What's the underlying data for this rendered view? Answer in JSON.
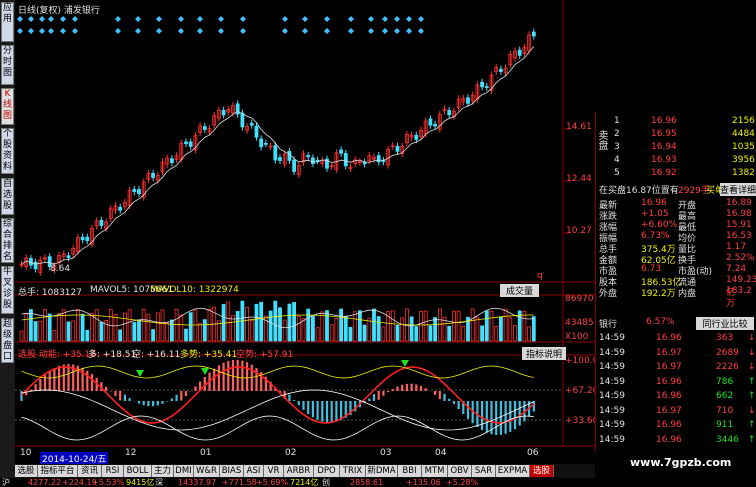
{
  "left_tabs": [
    {
      "label": "应用",
      "active": false
    },
    {
      "label": "分时图",
      "active": false
    },
    {
      "label": "K线图",
      "active": true
    },
    {
      "label": "个股资料",
      "active": false
    },
    {
      "label": "自选股",
      "active": false
    },
    {
      "label": "综合排名",
      "active": false
    },
    {
      "label": "牛叉诊股",
      "active": false
    },
    {
      "label": "超级盘口",
      "active": false
    }
  ],
  "chart_header": {
    "title": "日线(复权) 浦发银行"
  },
  "price_axis": {
    "labels": [
      "14.61",
      "12.44",
      "10.27"
    ],
    "low_marker": "8.64",
    "q_marker": "q"
  },
  "volume_header": {
    "total": "总手: 1083127",
    "mavol5": "MAVOL5: 1075661",
    "mavol10": "MAVOL10: 1322974",
    "dropdown": "成交量"
  },
  "volume_axis": {
    "labels": [
      "86970",
      "43485",
      "X100"
    ]
  },
  "indicator_header": {
    "name": "选股 动能: +35.18",
    "duo": "多: +18.51",
    "kong": "空: +16.11",
    "duoshi": "多势: +35.41",
    "kongshi": "空势: +57.91",
    "help": "指标说明"
  },
  "indicator_axis": {
    "labels": [
      "+100.0",
      "+67.20",
      "+33.60"
    ]
  },
  "x_axis": {
    "labels": [
      "10",
      "12",
      "01",
      "02",
      "03",
      "04",
      "06"
    ],
    "cursor_date": "2014-10-24/五"
  },
  "bottom_tabs": [
    "选股",
    "指标平台",
    "资讯",
    "RSI",
    "BOLL",
    "主力",
    "DMI",
    "W&R",
    "BIAS",
    "ASI",
    "VR",
    "ARBR",
    "DPO",
    "TRIX",
    "新DMA",
    "BBI",
    "MTM",
    "OBV",
    "SAR",
    "EXPMA",
    "选股"
  ],
  "active_bottom_tab": 20,
  "quote": {
    "sell_label": "卖盘",
    "asks": [
      {
        "level": "1",
        "price": "16.96",
        "vol": "2156"
      },
      {
        "level": "2",
        "price": "16.95",
        "vol": "4484"
      },
      {
        "level": "3",
        "price": "16.94",
        "vol": "1035"
      },
      {
        "level": "4",
        "price": "16.93",
        "vol": "3956"
      },
      {
        "level": "5",
        "price": "16.92",
        "vol": "1382"
      }
    ],
    "order_line": "在买盘16.87位置有",
    "order_vol": "2929手",
    "order_action": "买单!",
    "order_link": "查看详细",
    "stats": [
      {
        "l1": "最新",
        "v1": "16.96",
        "l2": "开盘",
        "v2": "16.89"
      },
      {
        "l1": "涨跌",
        "v1": "+1.05",
        "l2": "最高",
        "v2": "16.98"
      },
      {
        "l1": "涨幅",
        "v1": "+6.60%",
        "l2": "最低",
        "v2": "15.91"
      },
      {
        "l1": "振幅",
        "v1": "6.73%",
        "l2": "均价",
        "v2": "16.53"
      },
      {
        "l1": "总手",
        "v1": "375.4万",
        "l2": "量比",
        "v2": "1.17"
      },
      {
        "l1": "金额",
        "v1": "62.05亿",
        "l2": "换手",
        "v2": "2.52%"
      },
      {
        "l1": "市盈",
        "v1": "6.73",
        "l2": "市盈(动)",
        "v2": "7.24"
      },
      {
        "l1": "股本",
        "v1": "186.53亿",
        "l2": "流通",
        "v2": "149.23亿"
      },
      {
        "l1": "外盘",
        "v1": "192.2万",
        "l2": "内盘",
        "v2": "183.2万"
      }
    ],
    "industry": "银行",
    "industry_pct": "6.57%",
    "industry_btn": "同行业比较",
    "ticks": [
      {
        "time": "14:59",
        "price": "16.96",
        "vol": "363",
        "dir": "down"
      },
      {
        "time": "14:59",
        "price": "16.97",
        "vol": "2689",
        "dir": "down"
      },
      {
        "time": "14:59",
        "price": "16.97",
        "vol": "2226",
        "dir": "down"
      },
      {
        "time": "14:59",
        "price": "16.96",
        "vol": "786",
        "dir": "up"
      },
      {
        "time": "14:59",
        "price": "16.96",
        "vol": "662",
        "dir": "up"
      },
      {
        "time": "14:59",
        "price": "16.97",
        "vol": "710",
        "dir": "down"
      },
      {
        "time": "14:59",
        "price": "16.96",
        "vol": "911",
        "dir": "up"
      },
      {
        "time": "14:59",
        "price": "16.96",
        "vol": "3446",
        "dir": "up"
      }
    ]
  },
  "status_bar": {
    "items": [
      "沪",
      "4277.22",
      "+224.19",
      "+5.53%",
      "9415亿",
      "深",
      "14337.97",
      "+771.58",
      "+5.69%",
      "7214亿",
      "创",
      "2858.61",
      "+135.06",
      "+5.28%"
    ]
  },
  "watermark": "www.7gpzb.com",
  "colors": {
    "up": "#ff3030",
    "down": "#40e0ff",
    "bg": "#000000",
    "frame": "#8b0000",
    "ma": "#ffffff"
  }
}
